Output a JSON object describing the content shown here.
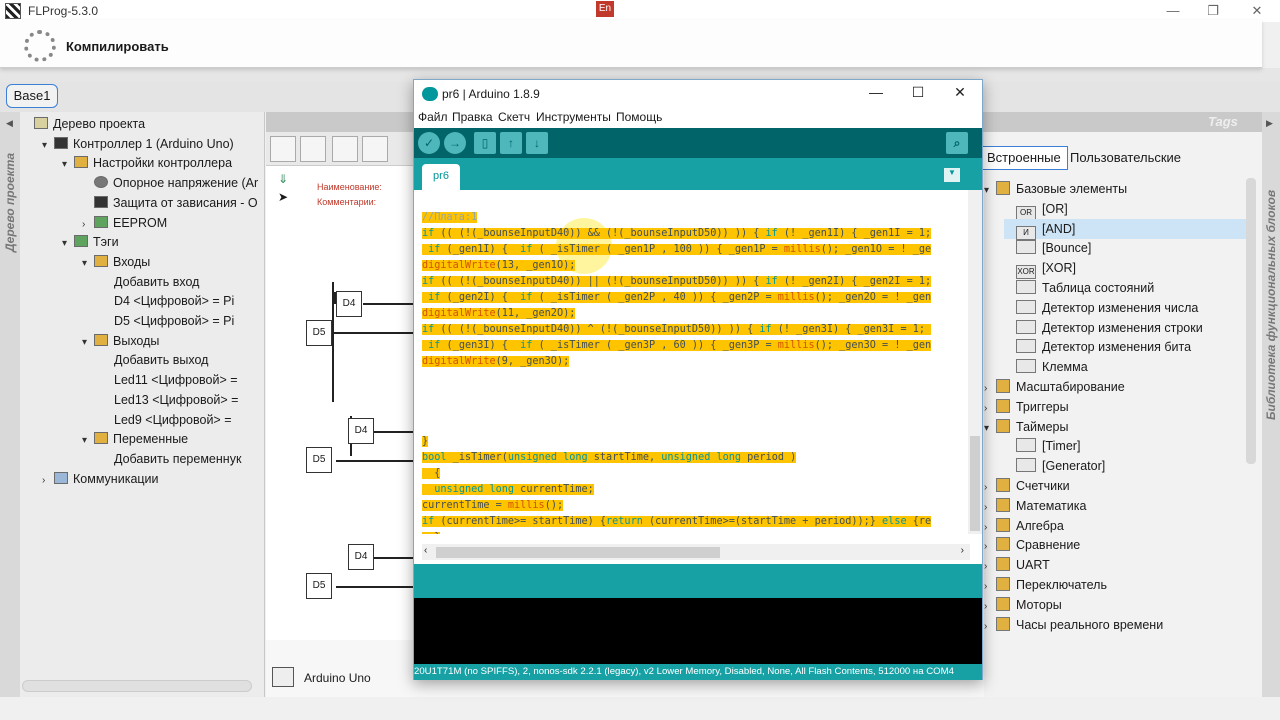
{
  "app": {
    "title": "FLProg-5.3.0",
    "lang_badge": "En",
    "controls": [
      "—",
      "❐",
      "✕"
    ]
  },
  "compile": {
    "label": "Компилировать"
  },
  "base_tab": "Base1",
  "left_panel": {
    "vertical_label": "Дерево проекта",
    "tree": [
      {
        "label": "Дерево проекта",
        "level": 0,
        "arrow": "",
        "icon": "doc"
      },
      {
        "label": "Контроллер 1 (Arduino Uno)",
        "level": 1,
        "arrow": "▾",
        "icon": "chip"
      },
      {
        "label": "Настройки контроллера",
        "level": 2,
        "arrow": "▾",
        "icon": "gear"
      },
      {
        "label": "Опорное напряжение (Ar",
        "level": 3,
        "arrow": "",
        "icon": "gauge"
      },
      {
        "label": "Защита от зависания - О",
        "level": 3,
        "arrow": "",
        "icon": "bolt"
      },
      {
        "label": "EEPROM",
        "level": 3,
        "arrow": "›",
        "icon": "memory"
      },
      {
        "label": "Тэги",
        "level": 2,
        "arrow": "▾",
        "icon": "tags"
      },
      {
        "label": "Входы",
        "level": 3,
        "arrow": "▾",
        "icon": "folder"
      },
      {
        "label": "Добавить вход",
        "level": 4,
        "arrow": "",
        "icon": ""
      },
      {
        "label": "D4 <Цифровой> = Pi",
        "level": 4,
        "arrow": "",
        "icon": ""
      },
      {
        "label": "D5 <Цифровой> = Pi",
        "level": 4,
        "arrow": "",
        "icon": ""
      },
      {
        "label": "Выходы",
        "level": 3,
        "arrow": "▾",
        "icon": "folder"
      },
      {
        "label": "Добавить выход",
        "level": 4,
        "arrow": "",
        "icon": ""
      },
      {
        "label": "Led11 <Цифровой> =",
        "level": 4,
        "arrow": "",
        "icon": ""
      },
      {
        "label": "Led13 <Цифровой> =",
        "level": 4,
        "arrow": "",
        "icon": ""
      },
      {
        "label": "Led9 <Цифровой> =",
        "level": 4,
        "arrow": "",
        "icon": ""
      },
      {
        "label": "Переменные",
        "level": 3,
        "arrow": "▾",
        "icon": "folder"
      },
      {
        "label": "Добавить переменнук",
        "level": 4,
        "arrow": "",
        "icon": ""
      },
      {
        "label": "Коммуникации",
        "level": 1,
        "arrow": "›",
        "icon": "pc"
      }
    ]
  },
  "center": {
    "name_label": "Наименование:",
    "comment_label": "Комментарии:",
    "blocks": [
      "D4",
      "D5",
      "D4",
      "D5",
      "D4",
      "D5"
    ],
    "bottom_tab": "Arduino Uno"
  },
  "right_panel": {
    "tags_label": "Tags",
    "vertical_label": "Библиотека функциональных блоков",
    "tabs": [
      "Встроенные",
      "Пользовательские"
    ],
    "items": [
      {
        "label": "Базовые элементы",
        "indent": 0,
        "arrow": "▾",
        "icon": "folder"
      },
      {
        "label": "[OR]",
        "indent": 1,
        "arrow": "",
        "icon": "OR"
      },
      {
        "label": "[AND]",
        "indent": 1,
        "arrow": "",
        "icon": "И",
        "selected": true
      },
      {
        "label": "[Bounce]",
        "indent": 1,
        "arrow": "",
        "icon": ""
      },
      {
        "label": "[XOR]",
        "indent": 1,
        "arrow": "",
        "icon": "XOR"
      },
      {
        "label": "Таблица состояний",
        "indent": 1,
        "arrow": "",
        "icon": ""
      },
      {
        "label": "Детектор изменения числа",
        "indent": 1,
        "arrow": "",
        "icon": ""
      },
      {
        "label": "Детектор изменения строки",
        "indent": 1,
        "arrow": "",
        "icon": ""
      },
      {
        "label": "Детектор изменения бита",
        "indent": 1,
        "arrow": "",
        "icon": ""
      },
      {
        "label": "Клемма",
        "indent": 1,
        "arrow": "",
        "icon": ""
      },
      {
        "label": "Масштабирование",
        "indent": 0,
        "arrow": "›",
        "icon": "folder"
      },
      {
        "label": "Триггеры",
        "indent": 0,
        "arrow": "›",
        "icon": "folder"
      },
      {
        "label": "Таймеры",
        "indent": 0,
        "arrow": "▾",
        "icon": "folder"
      },
      {
        "label": "[Timer]",
        "indent": 1,
        "arrow": "",
        "icon": ""
      },
      {
        "label": "[Generator]",
        "indent": 1,
        "arrow": "",
        "icon": ""
      },
      {
        "label": "Счетчики",
        "indent": 0,
        "arrow": "›",
        "icon": "folder"
      },
      {
        "label": "Математика",
        "indent": 0,
        "arrow": "›",
        "icon": "folder"
      },
      {
        "label": "Алгебра",
        "indent": 0,
        "arrow": "›",
        "icon": "folder"
      },
      {
        "label": "Сравнение",
        "indent": 0,
        "arrow": "›",
        "icon": "folder"
      },
      {
        "label": "UART",
        "indent": 0,
        "arrow": "›",
        "icon": "folder"
      },
      {
        "label": "Переключатель",
        "indent": 0,
        "arrow": "›",
        "icon": "folder"
      },
      {
        "label": "Моторы",
        "indent": 0,
        "arrow": "›",
        "icon": "folder"
      },
      {
        "label": "Часы реального времени",
        "indent": 0,
        "arrow": "›",
        "icon": "folder"
      }
    ]
  },
  "ide": {
    "title": "pr6 | Arduino 1.8.9",
    "controls": [
      "—",
      "☐",
      "✕"
    ],
    "menu": [
      "Файл",
      "Правка",
      "Скетч",
      "Инструменты",
      "Помощь"
    ],
    "toolbar": [
      "verify",
      "upload",
      "new",
      "open",
      "save"
    ],
    "tab": "pr6",
    "code_lines": [
      {
        "text": "//Плата:1",
        "hl": true
      },
      {
        "text": "if (( (!(_bounseInputD40)) && (!(_bounseInputD50)) )) { if (! _gen1I) { _gen1I = 1;",
        "hl": true
      },
      {
        "text": " if (_gen1I) {  if ( _isTimer ( _gen1P , 100 )) { _gen1P = millis(); _gen1O = ! _ge",
        "hl": true
      },
      {
        "text": "digitalWrite(13, _gen1O);",
        "hl": true
      },
      {
        "text": "if (( (!(_bounseInputD40)) || (!(_bounseInputD50)) )) { if (! _gen2I) { _gen2I = 1;",
        "hl": true
      },
      {
        "text": " if (_gen2I) {  if ( _isTimer ( _gen2P , 40 )) { _gen2P = millis(); _gen2O = ! _gen",
        "hl": true
      },
      {
        "text": "digitalWrite(11, _gen2O);",
        "hl": true
      },
      {
        "text": "if (( (!(_bounseInputD40)) ^ (!(_bounseInputD50)) )) { if (! _gen3I) { _gen3I = 1; ",
        "hl": true
      },
      {
        "text": " if (_gen3I) {  if ( _isTimer ( _gen3P , 60 )) { _gen3P = millis(); _gen3O = ! _gen",
        "hl": true
      },
      {
        "text": "digitalWrite(9, _gen3O);",
        "hl": true
      },
      {
        "text": "",
        "hl": false
      },
      {
        "text": "",
        "hl": false
      },
      {
        "text": "",
        "hl": false
      },
      {
        "text": "",
        "hl": false
      },
      {
        "text": "}",
        "hl": true
      },
      {
        "text": "bool _isTimer(unsigned long startTime, unsigned long period )",
        "hl": true
      },
      {
        "text": "  {",
        "hl": true
      },
      {
        "text": "  unsigned long currentTime;",
        "hl": true
      },
      {
        "text": "currentTime = millis();",
        "hl": true
      },
      {
        "text": "if (currentTime>= startTime) {return (currentTime>=(startTime + period));} else {re",
        "hl": true
      },
      {
        "text": "  }",
        "hl": true
      }
    ],
    "footer": "20U1T71M (no SPIFFS), 2, nonos-sdk 2.2.1 (legacy), v2 Lower Memory, Disabled, None, All Flash Contents, 512000 на COM4"
  }
}
